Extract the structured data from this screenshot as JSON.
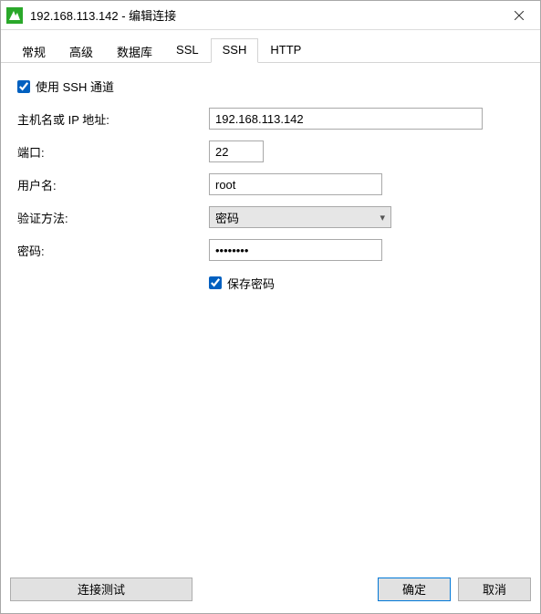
{
  "window": {
    "title": "192.168.113.142 - 编辑连接"
  },
  "tabs": [
    {
      "id": "general",
      "label": "常规",
      "active": false
    },
    {
      "id": "advanced",
      "label": "高级",
      "active": false
    },
    {
      "id": "database",
      "label": "数据库",
      "active": false
    },
    {
      "id": "ssl",
      "label": "SSL",
      "active": false
    },
    {
      "id": "ssh",
      "label": "SSH",
      "active": true
    },
    {
      "id": "http",
      "label": "HTTP",
      "active": false
    }
  ],
  "form": {
    "use_ssh_tunnel": {
      "label": "使用 SSH 通道",
      "checked": true
    },
    "host": {
      "label": "主机名或 IP 地址:",
      "value": "192.168.113.142"
    },
    "port": {
      "label": "端口:",
      "value": "22"
    },
    "username": {
      "label": "用户名:",
      "value": "root"
    },
    "auth_method": {
      "label": "验证方法:",
      "value": "密码"
    },
    "password": {
      "label": "密码:",
      "value": "••••••••"
    },
    "save_password": {
      "label": "保存密码",
      "checked": true
    }
  },
  "footer": {
    "test_connection": "连接测试",
    "ok": "确定",
    "cancel": "取消"
  }
}
